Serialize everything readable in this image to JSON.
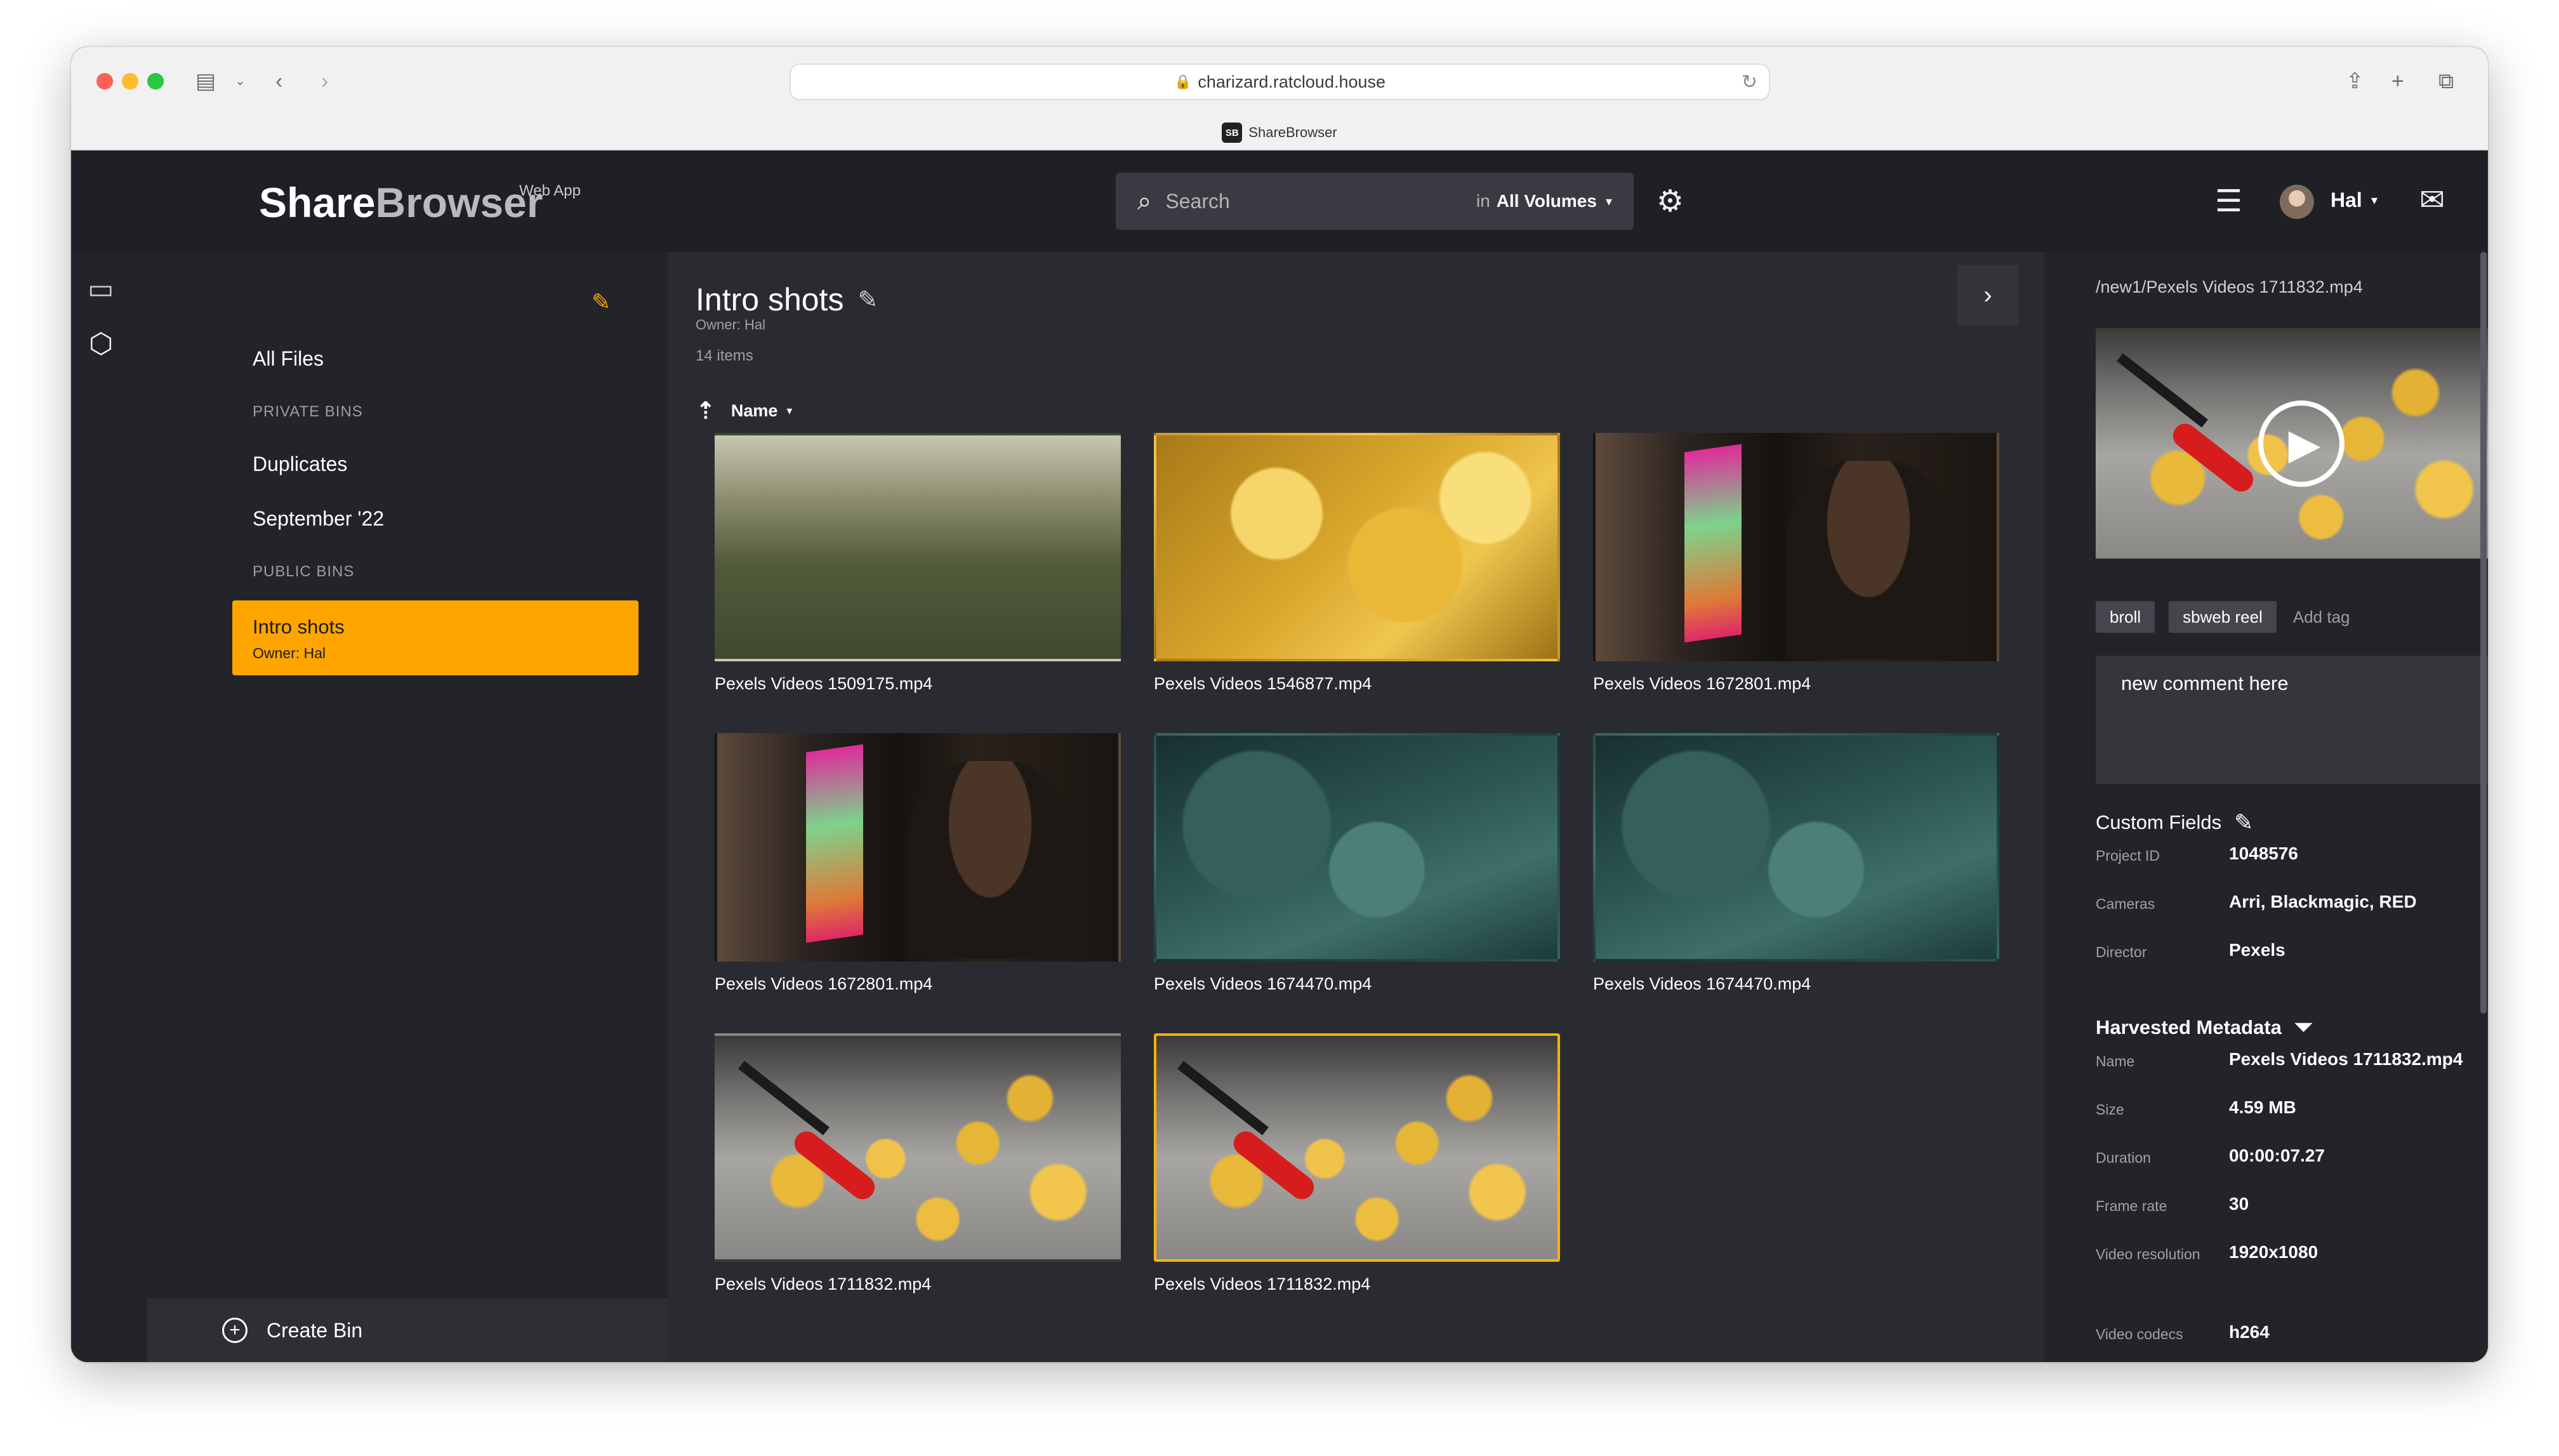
{
  "browser": {
    "url": "charizard.ratcloud.house",
    "tab_title": "ShareBrowser",
    "favicon_text": "SB"
  },
  "app": {
    "logo_bold": "Share",
    "logo_light": "Browser",
    "logo_sub": "Web App",
    "search": {
      "placeholder": "Search",
      "in_label": "in",
      "volume": "All Volumes"
    },
    "user": {
      "name": "Hal"
    }
  },
  "sidebar": {
    "all_files": "All Files",
    "private_heading": "PRIVATE BINS",
    "private_bins": [
      "Duplicates",
      "September '22"
    ],
    "public_heading": "PUBLIC BINS",
    "active_bin": {
      "name": "Intro shots",
      "owner": "Owner: Hal"
    },
    "create_bin": "Create Bin"
  },
  "main": {
    "title": "Intro shots",
    "owner": "Owner: Hal",
    "item_count": "14 items",
    "sort_label": "Name",
    "tiles": [
      {
        "name": "Pexels Videos 1509175.mp4",
        "thumb": "wheat"
      },
      {
        "name": "Pexels Videos 1546877.mp4",
        "thumb": "leaves"
      },
      {
        "name": "Pexels Videos 1672801.mp4",
        "thumb": "night"
      },
      {
        "name": "Pexels Videos 1672801.mp4",
        "thumb": "night"
      },
      {
        "name": "Pexels Videos 1674470.mp4",
        "thumb": "water"
      },
      {
        "name": "Pexels Videos 1674470.mp4",
        "thumb": "water"
      },
      {
        "name": "Pexels Videos 1711832.mp4",
        "thumb": "cookies"
      },
      {
        "name": "Pexels Videos 1711832.mp4",
        "thumb": "cookies",
        "selected": true
      }
    ]
  },
  "details": {
    "path": "/new1/Pexels Videos 1711832.mp4",
    "tags": [
      "broll",
      "sbweb reel"
    ],
    "add_tag": "Add tag",
    "comment": "new comment here",
    "custom_fields_title": "Custom Fields",
    "custom_fields": [
      {
        "label": "Project ID",
        "value": "1048576"
      },
      {
        "label": "Cameras",
        "value": "Arri, Blackmagic, RED"
      },
      {
        "label": "Director",
        "value": "Pexels"
      }
    ],
    "harvested_title": "Harvested Metadata",
    "harvested": [
      {
        "label": "Name",
        "value": "Pexels Videos 1711832.mp4"
      },
      {
        "label": "Size",
        "value": "4.59 MB"
      },
      {
        "label": "Duration",
        "value": "00:00:07.27"
      },
      {
        "label": "Frame rate",
        "value": "30"
      },
      {
        "label": "Video resolution",
        "value": "1920x1080"
      },
      {
        "label": "Video codecs",
        "value": "h264"
      }
    ]
  },
  "colors": {
    "accent": "#ffa500",
    "selected_border": "#ffb300",
    "app_bg": "#23242a",
    "main_bg": "#2a2b31"
  }
}
